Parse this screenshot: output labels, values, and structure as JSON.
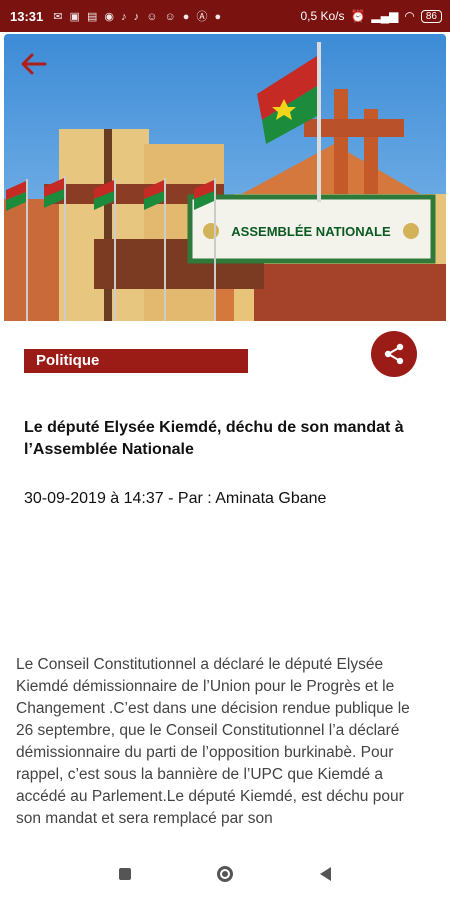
{
  "status_bar": {
    "time": "13:31",
    "network_speed": "0,5 Ko/s",
    "battery": "86"
  },
  "hero": {
    "sign_text": "ASSEMBLÉE NATIONALE"
  },
  "article": {
    "category": "Politique",
    "title": "Le député Elysée Kiemdé, déchu de son mandat à l’Assemblée Nationale",
    "meta": "30-09-2019 à 14:37 - Par : Aminata Gbane",
    "body": "Le Conseil Constitutionnel a déclaré le député Elysée Kiemdé démissionnaire de l’Union pour le Progrès et le Changement .C’est dans une décision rendue publique le 26 septembre, que le Conseil Constitutionnel l’a déclaré démissionnaire du parti de l’opposition burkinabè. Pour rappel, c’est sous la bannière de l’UPC que Kiemdé a accédé au Parlement.Le député Kiemdé, est déchu pour son mandat et sera remplacé par son"
  },
  "colors": {
    "accent": "#9b1b17",
    "status_bar": "#7a1210"
  },
  "icons": {
    "back": "arrow-left-icon",
    "share": "share-icon",
    "nav_recents": "square-icon",
    "nav_home": "circle-icon",
    "nav_back": "triangle-back-icon"
  }
}
